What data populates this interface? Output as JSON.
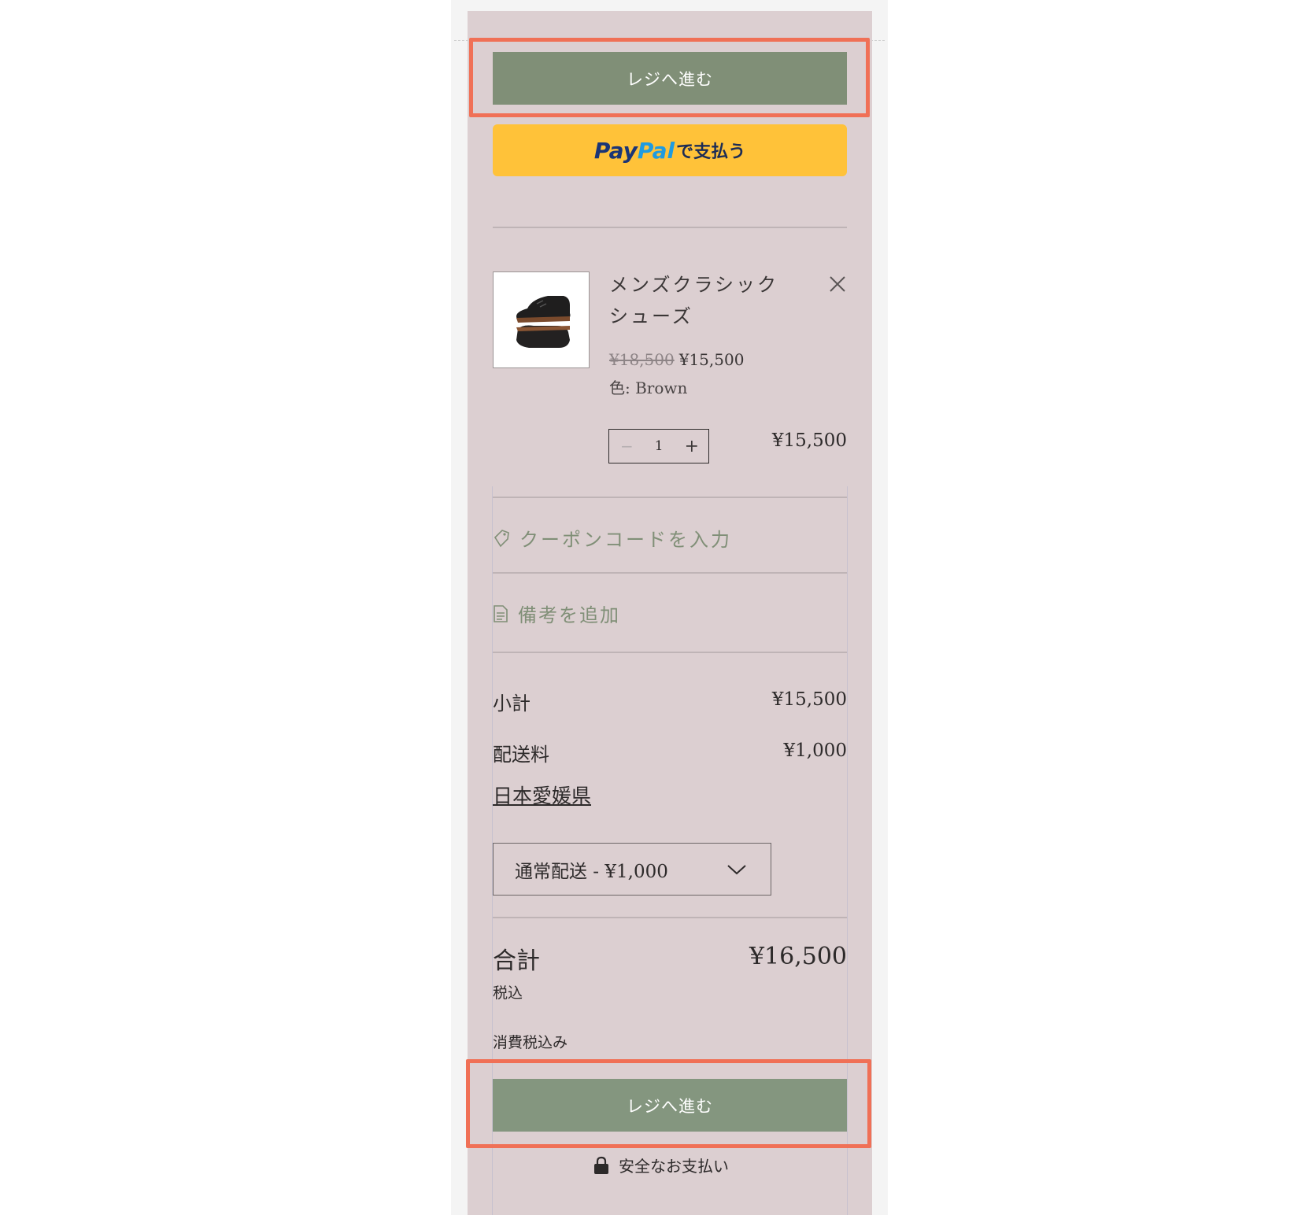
{
  "cart": {
    "checkout_button_top": "レジへ進む",
    "paypal_button": {
      "brand_pay": "Pay",
      "brand_pal": "Pal",
      "suffix": "で支払う"
    },
    "item": {
      "name": "メンズクラシックシューズ",
      "original_price": "¥18,500",
      "sale_price": "¥15,500",
      "option": "色: Brown",
      "quantity": "1",
      "line_total": "¥15,500",
      "image_icon": "shoes-image"
    },
    "coupon_label": "クーポンコードを入力",
    "note_label": "備考を追加",
    "summary": {
      "subtotal_label": "小計",
      "subtotal_value": "¥15,500",
      "shipping_label": "配送料",
      "shipping_value": "¥1,000",
      "region": "日本愛媛県",
      "shipping_option": "通常配送 - ¥1,000",
      "total_label": "合計",
      "total_value": "¥16,500",
      "tax_included": "税込",
      "tax_note": "消費税込み"
    },
    "checkout_button_bottom": "レジへ進む",
    "secure_label": "安全なお支払い"
  },
  "colors": {
    "panel_bg": "#dccfd1",
    "checkout_green": "#808f77",
    "paypal_yellow": "#ffc239",
    "highlight": "#f07056"
  },
  "icons": [
    "close-icon",
    "tag-icon",
    "note-icon",
    "chevron-down-icon",
    "lock-icon"
  ]
}
